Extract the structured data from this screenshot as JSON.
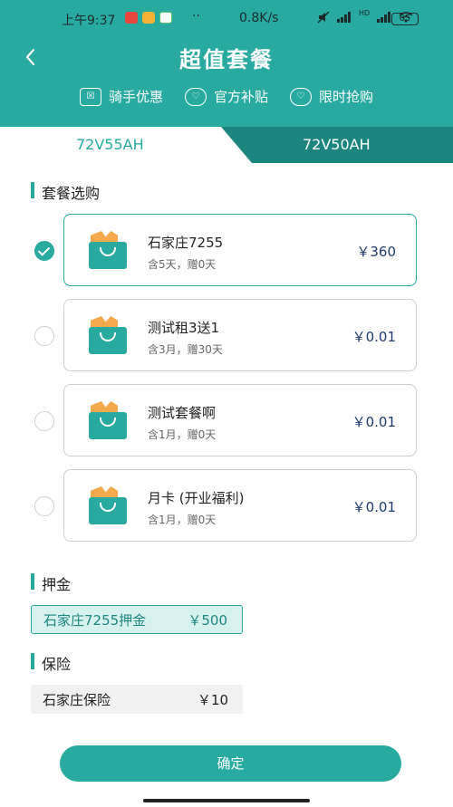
{
  "status_bar": {
    "time": "上午9:37",
    "dots": "··",
    "speed": "0.8K/s",
    "battery": "65",
    "network_badge": "HD"
  },
  "header": {
    "back_icon": "chevron-left-icon",
    "title": "超值套餐",
    "promos": [
      {
        "label": "骑手优惠",
        "icon": "ticket-icon"
      },
      {
        "label": "官方补贴",
        "icon": "heart-icon"
      },
      {
        "label": "限时抢购",
        "icon": "heart-icon"
      }
    ]
  },
  "tabs": [
    {
      "label": "72V55AH",
      "active": true
    },
    {
      "label": "72V50AH",
      "active": false
    }
  ],
  "package_section": {
    "title": "套餐选购"
  },
  "packages": [
    {
      "name": "石家庄7255",
      "sub": "含5天，赠0天",
      "price": "￥360",
      "selected": true
    },
    {
      "name": "测试租3送1",
      "sub": "含3月，赠30天",
      "price": "￥0.01",
      "selected": false
    },
    {
      "name": "测试套餐啊",
      "sub": "含1月，赠0天",
      "price": "￥0.01",
      "selected": false
    },
    {
      "name": "月卡 (开业福利)",
      "sub": "含1月，赠0天",
      "price": "￥0.01",
      "selected": false
    }
  ],
  "deposit": {
    "title": "押金",
    "label": "石家庄7255押金",
    "price": "￥500"
  },
  "insurance": {
    "title": "保险",
    "label": "石家庄保险",
    "price": "￥10"
  },
  "confirm_label": "确定",
  "colors": {
    "accent": "#28aaa0",
    "dark_accent": "#1d8580",
    "bag_orange": "#f4a94c",
    "price_blue": "#1f3a6e"
  }
}
